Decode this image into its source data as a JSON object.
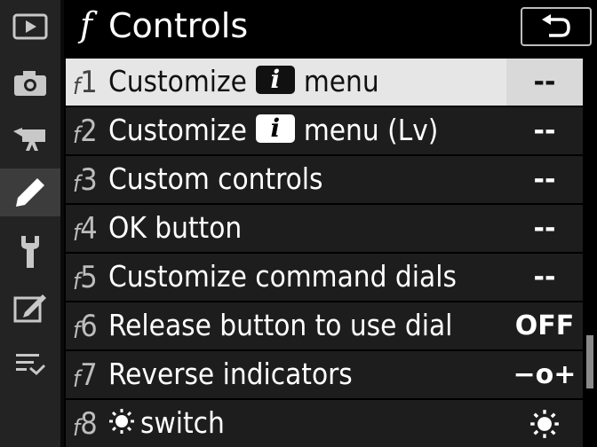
{
  "sidebar": {
    "items": [
      {
        "icon": "playback-icon"
      },
      {
        "icon": "camera-icon"
      },
      {
        "icon": "movie-camera-icon"
      },
      {
        "icon": "pencil-icon",
        "active": true
      },
      {
        "icon": "wrench-icon"
      },
      {
        "icon": "retouch-icon"
      },
      {
        "icon": "my-menu-icon"
      }
    ]
  },
  "header": {
    "f_glyph": "f",
    "title": "Controls",
    "back_icon": "return-arrow-icon"
  },
  "menu": {
    "items": [
      {
        "code_letter": "f",
        "code_num": "1",
        "label_pre": "Customize",
        "badge": "i",
        "label_post": "menu",
        "value": "--",
        "selected": true
      },
      {
        "code_letter": "f",
        "code_num": "2",
        "label_pre": "Customize",
        "badge": "i",
        "label_post": "menu (Lv)",
        "value": "--"
      },
      {
        "code_letter": "f",
        "code_num": "3",
        "label": "Custom controls",
        "value": "--"
      },
      {
        "code_letter": "f",
        "code_num": "4",
        "label": "OK button",
        "value": "--"
      },
      {
        "code_letter": "f",
        "code_num": "5",
        "label": "Customize command dials",
        "value": "--"
      },
      {
        "code_letter": "f",
        "code_num": "6",
        "label": "Release button to use dial",
        "value": "OFF"
      },
      {
        "code_letter": "f",
        "code_num": "7",
        "label": "Reverse indicators",
        "value": "−o+"
      },
      {
        "code_letter": "f",
        "code_num": "8",
        "label_icon": "illumination-icon",
        "label": "switch",
        "value_icon": "illumination-icon"
      }
    ]
  },
  "colors": {
    "background": "#000000",
    "row": "#1d1d1d",
    "selected_row": "#e6e6e6",
    "sidebar": "#232323"
  }
}
